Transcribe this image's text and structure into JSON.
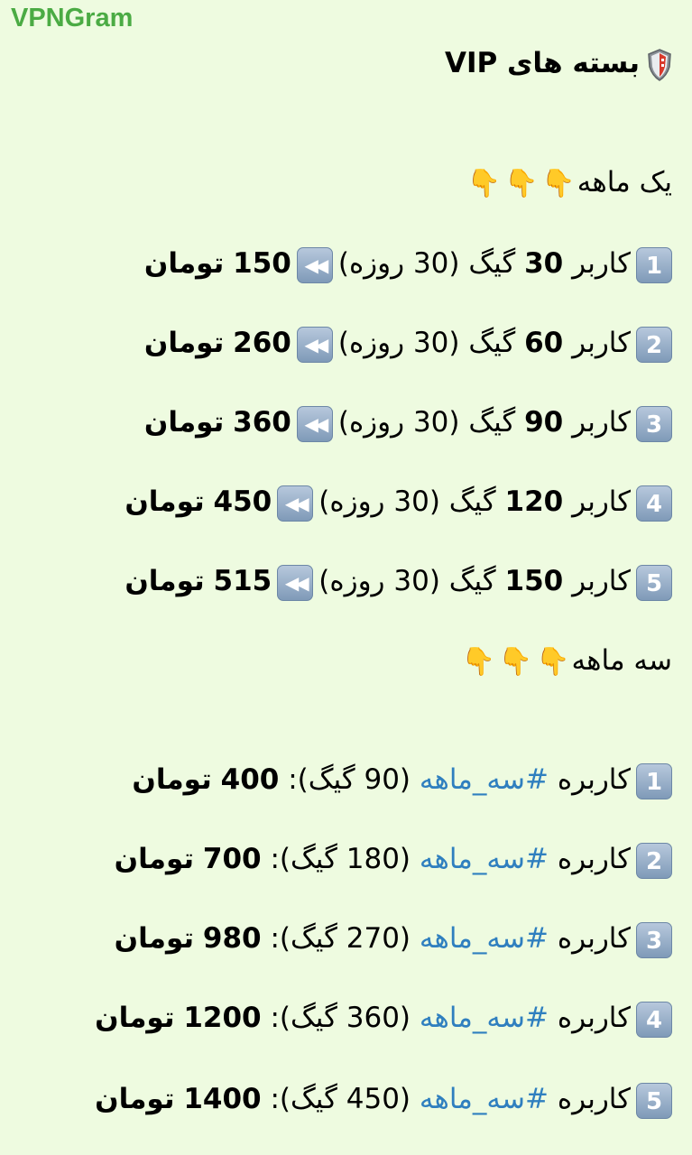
{
  "message": {
    "sender": "VPNGram",
    "title": "بسته های VIP",
    "title_icon": "shield-icon",
    "accent_colors": {
      "sender": "#4bab44",
      "hashtag": "#2f7fbf",
      "background": "#eefbe0"
    },
    "section1": {
      "heading": "یک ماهه",
      "icon": "pointing-down-hand-icon",
      "items": [
        {
          "badge": "1",
          "user_label": "کاربر",
          "gb": "30",
          "gb_unit": "گیگ",
          "duration": "(30 روزه)",
          "price": "150",
          "currency": "تومان"
        },
        {
          "badge": "2",
          "user_label": "کاربر",
          "gb": "60",
          "gb_unit": "گیگ",
          "duration": "(30 روزه)",
          "price": "260",
          "currency": "تومان"
        },
        {
          "badge": "3",
          "user_label": "کاربر",
          "gb": "90",
          "gb_unit": "گیگ",
          "duration": "(30 روزه)",
          "price": "360",
          "currency": "تومان"
        },
        {
          "badge": "4",
          "user_label": "کاربر",
          "gb": "120",
          "gb_unit": "گیگ",
          "duration": "(30 روزه)",
          "price": "450",
          "currency": "تومان"
        },
        {
          "badge": "5",
          "user_label": "کاربر",
          "gb": "150",
          "gb_unit": "گیگ",
          "duration": "(30 روزه)",
          "price": "515",
          "currency": "تومان"
        }
      ]
    },
    "section2": {
      "heading": "سه ماهه",
      "icon": "pointing-down-hand-icon",
      "items": [
        {
          "badge": "1",
          "user_label": "کاربره",
          "tag": "#سه_ماهه",
          "gb": "(90 گیگ):",
          "price": "400",
          "currency": "تومان"
        },
        {
          "badge": "2",
          "user_label": "کاربره",
          "tag": "#سه_ماهه",
          "gb": "(180 گیگ):",
          "price": "700",
          "currency": "تومان"
        },
        {
          "badge": "3",
          "user_label": "کاربره",
          "tag": "#سه_ماهه",
          "gb": "(270 گیگ):",
          "price": "980",
          "currency": "تومان"
        },
        {
          "badge": "4",
          "user_label": "کاربره",
          "tag": "#سه_ماهه",
          "gb": "(360 گیگ):",
          "price": "1200",
          "currency": "تومان"
        },
        {
          "badge": "5",
          "user_label": "کاربره",
          "tag": "#سه_ماهه",
          "gb": "(450 گیگ):",
          "price": "1400",
          "currency": "تومان"
        }
      ]
    }
  }
}
